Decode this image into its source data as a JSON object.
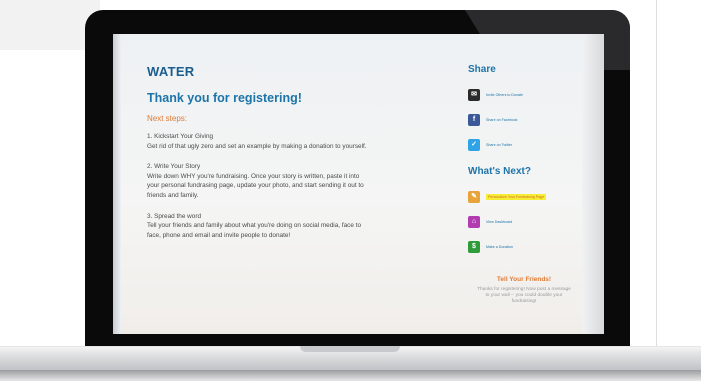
{
  "main": {
    "title": "WATER",
    "heading": "Thank you for registering!",
    "next_steps_label": "Next steps:",
    "steps": [
      {
        "title": "1. Kickstart Your Giving",
        "lines": [
          "Get rid of that ugly zero and set an example by making a donation to yourself."
        ]
      },
      {
        "title": "2. Write Your Story",
        "lines": [
          "Write down WHY you're fundraising. Once your story is written, paste it into",
          "your personal fundrasing page, update your photo, and start sending it out to",
          "friends and family."
        ]
      },
      {
        "title": "3. Spread the word",
        "lines": [
          "Tell your friends and family about what you're doing on social media, face to",
          "face, phone and email and invite people to donate!"
        ]
      }
    ]
  },
  "sidebar": {
    "share_heading": "Share",
    "share_items": [
      {
        "label": "Invite Others to Donate",
        "icon": "email-icon",
        "color": "#2b2b2b"
      },
      {
        "label": "Share on Facebook",
        "icon": "facebook-icon",
        "color": "#3b5998"
      },
      {
        "label": "Share on Twitter",
        "icon": "twitter-icon",
        "color": "#2fa3e6"
      }
    ],
    "next_heading": "What's Next?",
    "next_items": [
      {
        "label": "Personalize Your Fundraising Page",
        "icon": "pencil-icon",
        "color": "#e8a43a",
        "highlighted": true
      },
      {
        "label": "View Dashboard",
        "icon": "home-icon",
        "color": "#b23bb0",
        "highlighted": false
      },
      {
        "label": "Make a Donation",
        "icon": "money-icon",
        "color": "#2f9b3a",
        "highlighted": false
      }
    ],
    "tell_heading": "Tell Your Friends!",
    "tell_text": "Thanks for registering! Now post a message to your wall -- you could double your fundraising!"
  }
}
